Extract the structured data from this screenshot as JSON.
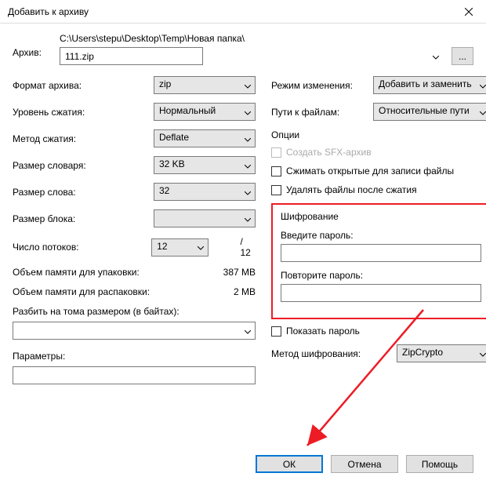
{
  "title": "Добавить к архиву",
  "archive": {
    "label": "Архив:",
    "path": "C:\\Users\\stepu\\Desktop\\Temp\\Новая папка\\",
    "filename": "111.zip",
    "browse": "..."
  },
  "left": {
    "format": {
      "label": "Формат архива:",
      "value": "zip"
    },
    "level": {
      "label": "Уровень сжатия:",
      "value": "Нормальный"
    },
    "method": {
      "label": "Метод сжатия:",
      "value": "Deflate"
    },
    "dict": {
      "label": "Размер словаря:",
      "value": "32 KB"
    },
    "word": {
      "label": "Размер слова:",
      "value": "32"
    },
    "block": {
      "label": "Размер блока:",
      "value": ""
    },
    "threads": {
      "label": "Число потоков:",
      "value": "12",
      "total": "/ 12"
    },
    "mem_pack": {
      "label": "Объем памяти для упаковки:",
      "value": "387 MB"
    },
    "mem_unpack": {
      "label": "Объем памяти для распаковки:",
      "value": "2 MB"
    },
    "split": {
      "label": "Разбить на тома размером (в байтах):",
      "value": ""
    },
    "params": {
      "label": "Параметры:",
      "value": ""
    }
  },
  "right": {
    "mode": {
      "label": "Режим изменения:",
      "value": "Добавить и заменить"
    },
    "paths": {
      "label": "Пути к файлам:",
      "value": "Относительные пути"
    },
    "options": {
      "title": "Опции",
      "sfx": "Создать SFX-архив",
      "compress_open": "Сжимать открытые для записи файлы",
      "delete_after": "Удалять файлы после сжатия"
    },
    "encryption": {
      "title": "Шифрование",
      "enter_pw": "Введите пароль:",
      "repeat_pw": "Повторите пароль:",
      "show_pw": "Показать пароль",
      "method_label": "Метод шифрования:",
      "method_value": "ZipCrypto"
    }
  },
  "buttons": {
    "ok": "ОК",
    "cancel": "Отмена",
    "help": "Помощь"
  }
}
